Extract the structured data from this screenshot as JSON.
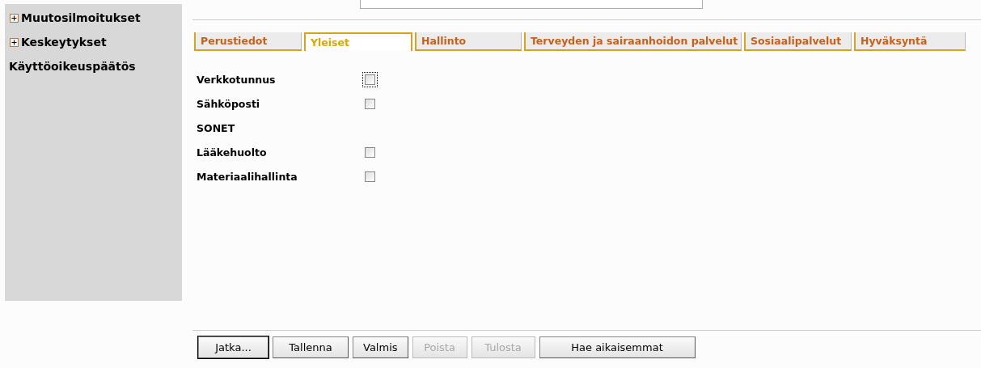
{
  "sidebar": {
    "items": [
      {
        "label": "Muutosilmoitukset",
        "kind": "expandable",
        "expanded": false
      },
      {
        "label": "Keskeytykset",
        "kind": "expandable",
        "expanded": false
      },
      {
        "label": "Käyttöoikeuspäätös",
        "kind": "plain"
      }
    ]
  },
  "tabs": [
    {
      "label": "Perustiedot",
      "selected": false
    },
    {
      "label": "Yleiset",
      "selected": true
    },
    {
      "label": "Hallinto",
      "selected": false
    },
    {
      "label": "Terveyden ja sairaanhoidon palvelut",
      "selected": false
    },
    {
      "label": "Sosiaalipalvelut",
      "selected": false
    },
    {
      "label": "Hyväksyntä",
      "selected": false
    }
  ],
  "form": [
    {
      "kind": "checkbox",
      "label": "Verkkotunnus",
      "checked": false,
      "focused": true
    },
    {
      "kind": "checkbox",
      "label": "Sähköposti",
      "checked": false,
      "focused": false
    },
    {
      "kind": "heading",
      "label": "SONET"
    },
    {
      "kind": "checkbox",
      "label": "Lääkehuolto",
      "checked": false,
      "focused": false
    },
    {
      "kind": "checkbox",
      "label": "Materiaalihallinta",
      "checked": false,
      "focused": false
    }
  ],
  "buttons": [
    {
      "label": "Jatka...",
      "default": true,
      "disabled": false
    },
    {
      "label": "Tallenna",
      "default": false,
      "disabled": false
    },
    {
      "label": "Valmis",
      "default": false,
      "disabled": false
    },
    {
      "label": "Poista",
      "default": false,
      "disabled": true
    },
    {
      "label": "Tulosta",
      "default": false,
      "disabled": true
    },
    {
      "label": "Hae aikaisemmat",
      "default": false,
      "disabled": false
    }
  ]
}
